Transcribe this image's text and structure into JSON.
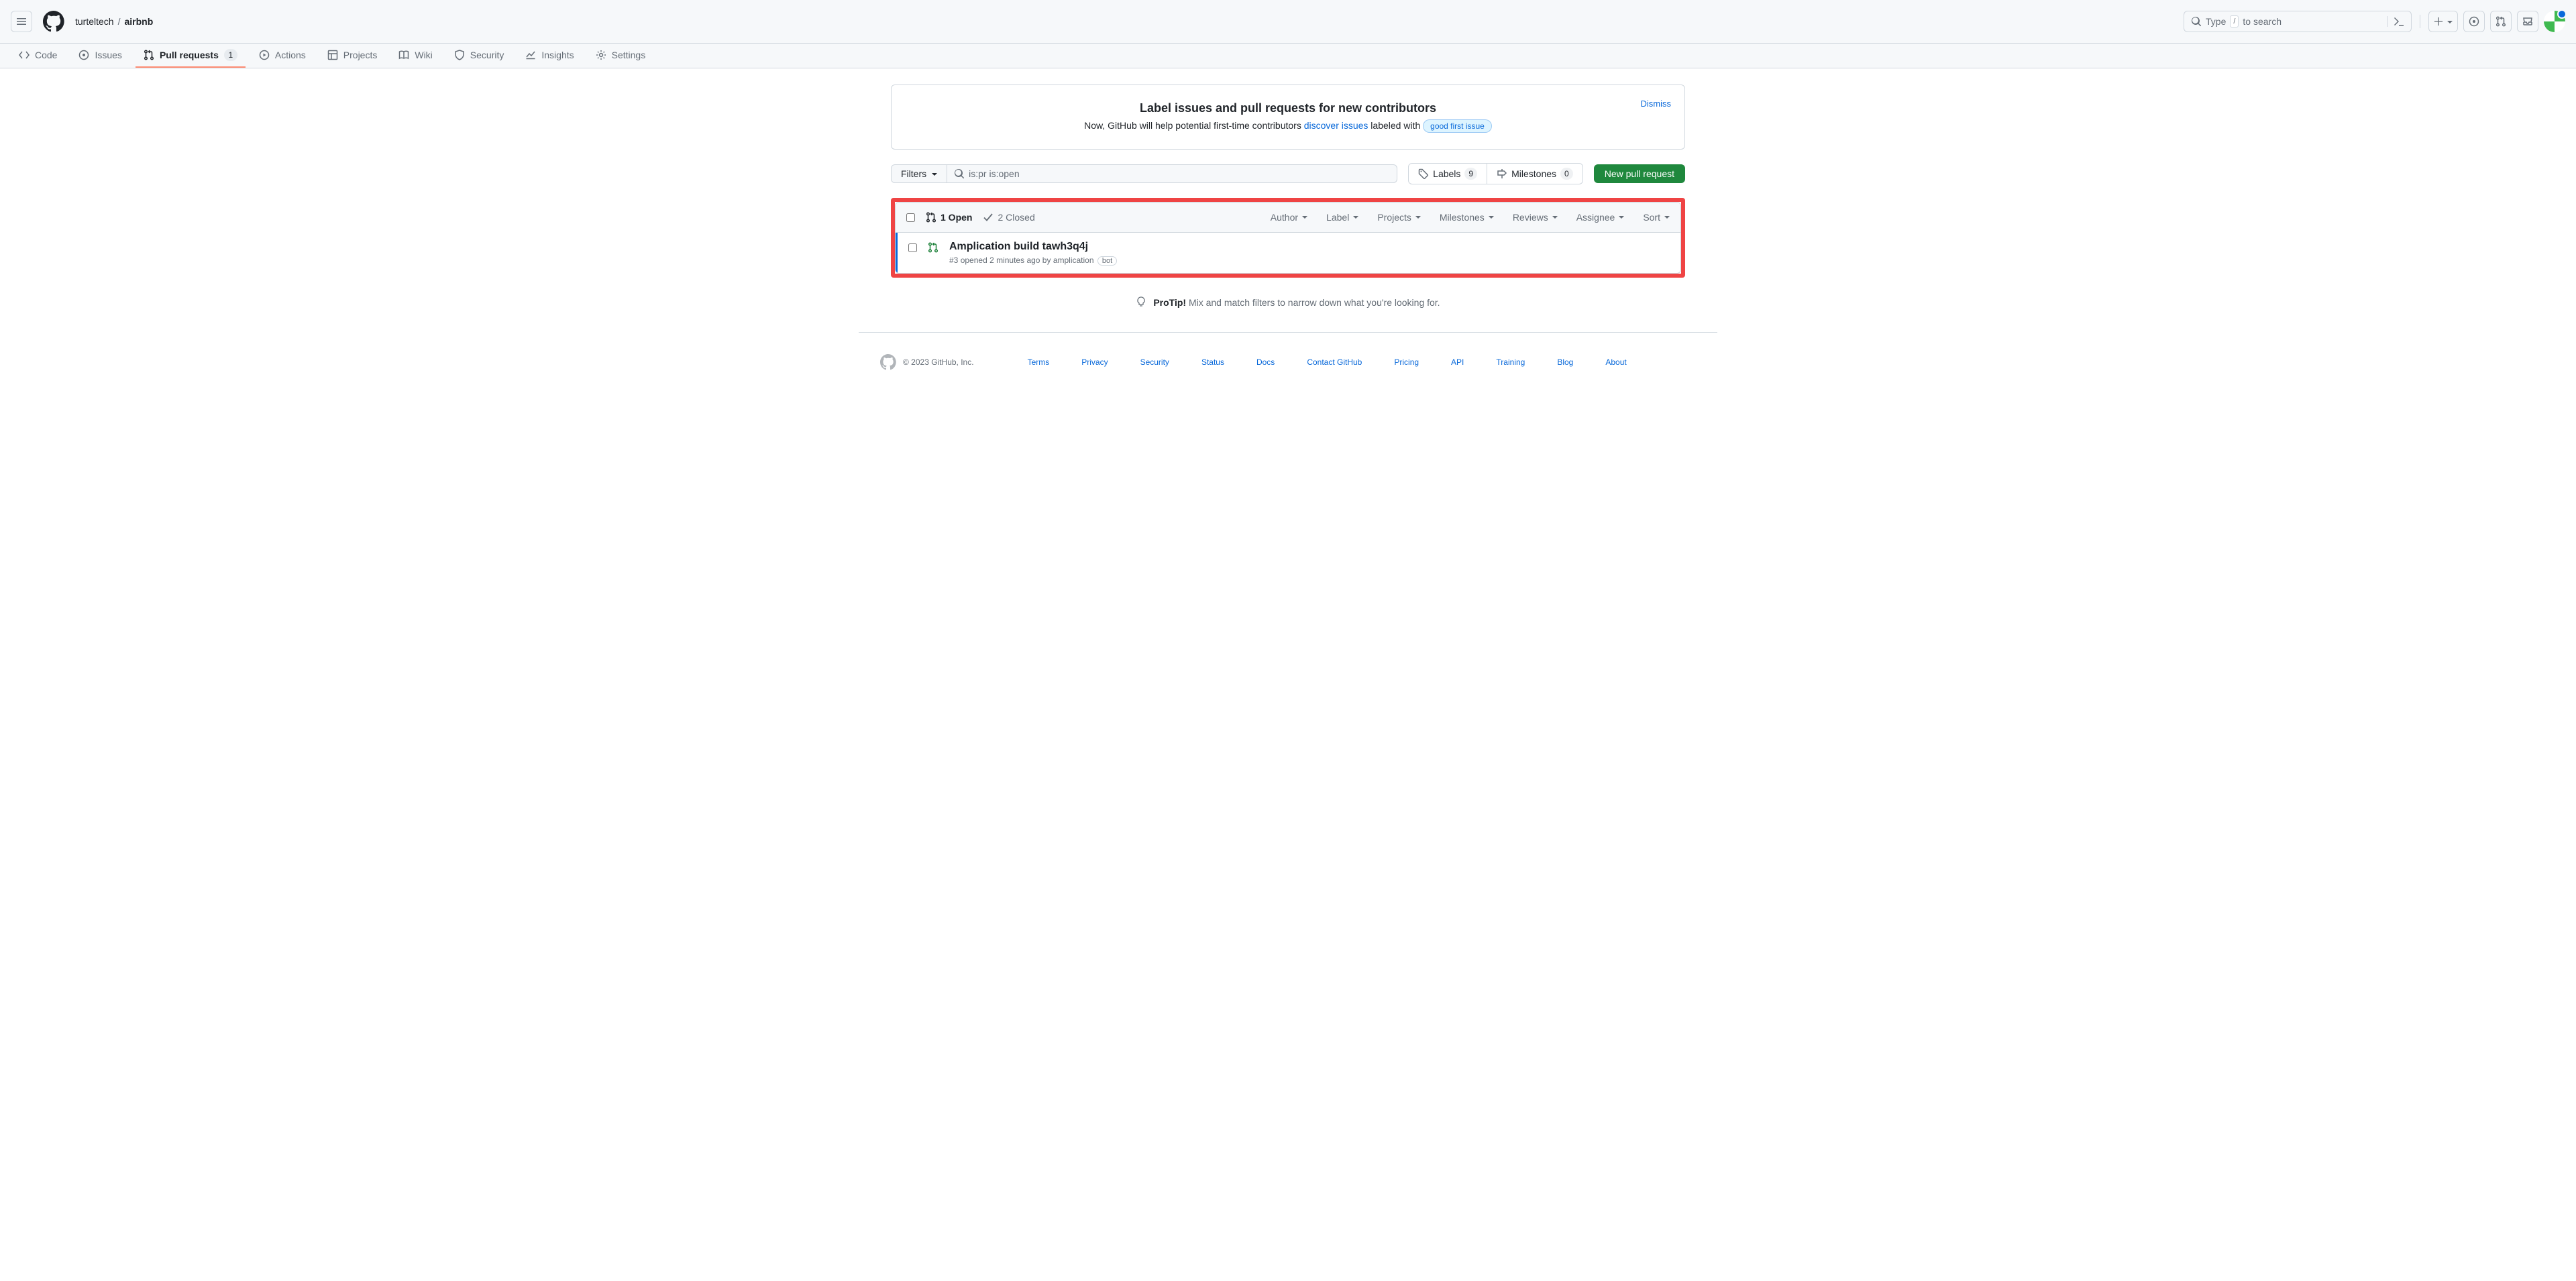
{
  "header": {
    "owner": "turteltech",
    "repo": "airbnb",
    "search_prefix": "Type",
    "search_suffix": "to search",
    "search_key": "/"
  },
  "nav": {
    "code": "Code",
    "issues": "Issues",
    "pull_requests": "Pull requests",
    "pr_count": "1",
    "actions": "Actions",
    "projects": "Projects",
    "wiki": "Wiki",
    "security": "Security",
    "insights": "Insights",
    "settings": "Settings"
  },
  "notice": {
    "title": "Label issues and pull requests for new contributors",
    "text_prefix": "Now, GitHub will help potential first-time contributors ",
    "link": "discover issues",
    "text_mid": " labeled with ",
    "label": "good first issue",
    "dismiss": "Dismiss"
  },
  "toolbar": {
    "filters": "Filters",
    "search_value": "is:pr is:open",
    "labels": "Labels",
    "labels_count": "9",
    "milestones": "Milestones",
    "milestones_count": "0",
    "new_pr": "New pull request"
  },
  "list": {
    "open": "1 Open",
    "closed": "2 Closed",
    "filters": {
      "author": "Author",
      "label": "Label",
      "projects": "Projects",
      "milestones": "Milestones",
      "reviews": "Reviews",
      "assignee": "Assignee",
      "sort": "Sort"
    }
  },
  "pr": {
    "title": "Amplication build tawh3q4j",
    "meta_num": "#3",
    "meta_opened": " opened ",
    "meta_time": "2 minutes ago",
    "meta_by": " by ",
    "meta_author": "amplication",
    "bot": "bot"
  },
  "protip": {
    "label": "ProTip!",
    "text": " Mix and match filters to narrow down what you're looking for."
  },
  "footer": {
    "copy": "© 2023 GitHub, Inc.",
    "links": [
      "Terms",
      "Privacy",
      "Security",
      "Status",
      "Docs",
      "Contact GitHub",
      "Pricing",
      "API",
      "Training",
      "Blog",
      "About"
    ]
  }
}
